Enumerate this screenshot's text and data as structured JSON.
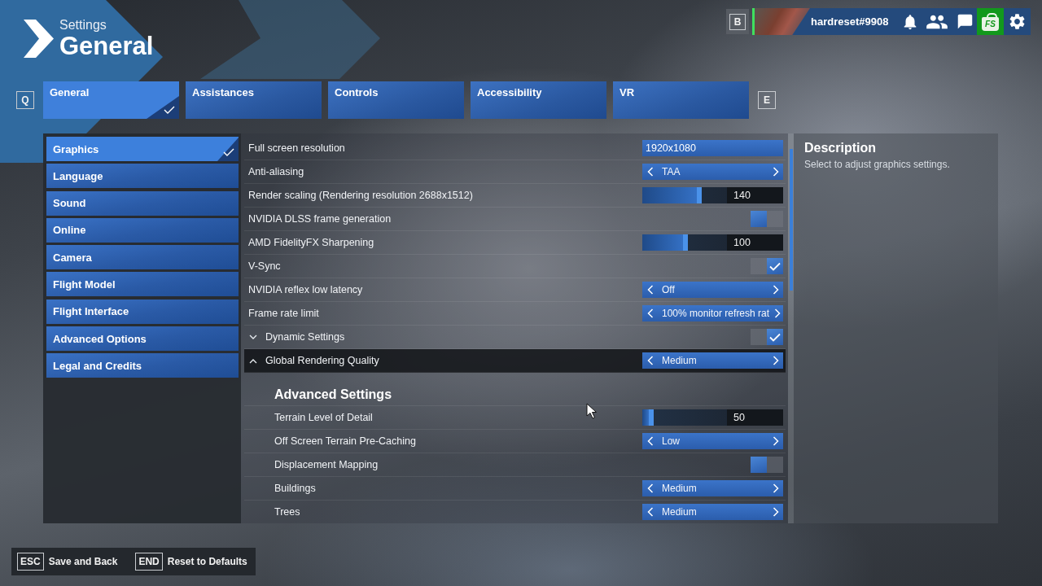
{
  "header": {
    "subtitle": "Settings",
    "title": "General"
  },
  "profile": {
    "key_hint": "B",
    "username": "hardreset#9908",
    "store_label": "FS"
  },
  "tab_bar": {
    "prev_key": "Q",
    "next_key": "E",
    "tabs": [
      {
        "label": "General",
        "selected": true
      },
      {
        "label": "Assistances",
        "selected": false
      },
      {
        "label": "Controls",
        "selected": false
      },
      {
        "label": "Accessibility",
        "selected": false
      },
      {
        "label": "VR",
        "selected": false
      }
    ]
  },
  "sidebar": {
    "items": [
      {
        "label": "Graphics",
        "selected": true
      },
      {
        "label": "Language",
        "selected": false
      },
      {
        "label": "Sound",
        "selected": false
      },
      {
        "label": "Online",
        "selected": false
      },
      {
        "label": "Camera",
        "selected": false
      },
      {
        "label": "Flight Model",
        "selected": false
      },
      {
        "label": "Flight Interface",
        "selected": false
      },
      {
        "label": "Advanced Options",
        "selected": false
      },
      {
        "label": "Legal and Credits",
        "selected": false
      }
    ]
  },
  "settings": {
    "rows": [
      {
        "label": "Full screen resolution",
        "kind": "dropdown",
        "value": "1920x1080",
        "selected": false
      },
      {
        "label": "Anti-aliasing",
        "kind": "selector",
        "value": "TAA",
        "selected": false
      },
      {
        "label": "Render scaling (Rendering resolution 2688x1512)",
        "kind": "slider",
        "level": 0.7,
        "reading": "140",
        "selected": false
      },
      {
        "label": "NVIDIA DLSS frame generation",
        "kind": "toggle",
        "on": false,
        "selected": false
      },
      {
        "label": "AMD FidelityFX Sharpening",
        "kind": "slider",
        "level": 0.54,
        "reading": "100",
        "selected": false
      },
      {
        "label": "V-Sync",
        "kind": "toggle",
        "on": true,
        "selected": false
      },
      {
        "label": "NVIDIA reflex low latency",
        "kind": "selector",
        "value": "Off",
        "selected": false
      },
      {
        "label": "Frame rate limit",
        "kind": "selector",
        "value": "100% monitor refresh rat",
        "selected": false
      },
      {
        "label": "Dynamic Settings",
        "kind": "toggle",
        "on": true,
        "expanded": false,
        "selected": false
      },
      {
        "label": "Global Rendering Quality",
        "kind": "selector",
        "value": "Medium",
        "expanded": true,
        "selected": true
      }
    ],
    "advanced_settings": {
      "title": "Advanced Settings",
      "rows": [
        {
          "label": "Terrain Level of Detail",
          "kind": "slider",
          "level": 0.13,
          "reading": "50",
          "selected": false
        },
        {
          "label": "Off Screen Terrain Pre-Caching",
          "kind": "selector",
          "value": "Low",
          "selected": false
        },
        {
          "label": "Displacement Mapping",
          "kind": "toggle",
          "on": false,
          "selected": false
        },
        {
          "label": "Buildings",
          "kind": "selector",
          "value": "Medium",
          "selected": false
        },
        {
          "label": "Trees",
          "kind": "selector",
          "value": "Medium",
          "selected": false
        }
      ]
    }
  },
  "description": {
    "title": "Description",
    "text": "Select to adjust graphics settings."
  },
  "footer": {
    "actions": [
      {
        "key": "ESC",
        "label": "Save and Back"
      },
      {
        "key": "END",
        "label": "Reset to Defaults"
      }
    ]
  }
}
